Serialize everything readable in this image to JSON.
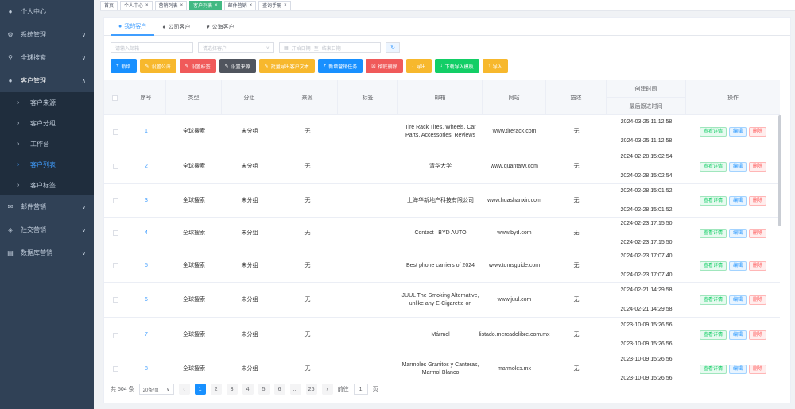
{
  "sidebar": {
    "items": [
      {
        "label": "个人中心",
        "icon": "user-icon"
      },
      {
        "label": "系统管理",
        "icon": "gear-icon"
      },
      {
        "label": "全球搜索",
        "icon": "search-icon"
      },
      {
        "label": "客户管理",
        "icon": "user-icon"
      },
      {
        "label": "邮件营销",
        "icon": "mail-icon"
      },
      {
        "label": "社交营销",
        "icon": "share-icon"
      },
      {
        "label": "数据库营销",
        "icon": "database-icon"
      }
    ],
    "subitems": [
      {
        "label": "客户来源"
      },
      {
        "label": "客户分组"
      },
      {
        "label": "工作台"
      },
      {
        "label": "客户列表"
      },
      {
        "label": "客户标签"
      }
    ]
  },
  "tags": [
    {
      "label": "首页"
    },
    {
      "label": "个人中心"
    },
    {
      "label": "营销列表"
    },
    {
      "label": "客户列表"
    },
    {
      "label": "邮件营销"
    },
    {
      "label": "查询手册"
    }
  ],
  "tabs": [
    {
      "label": "我的客户",
      "icon": "user-icon"
    },
    {
      "label": "公司客户",
      "icon": "user-icon"
    },
    {
      "label": "公海客户",
      "icon": "heart-icon"
    }
  ],
  "filters": {
    "keyword_placeholder": "请输入邮箱",
    "select_placeholder": "请选择客户",
    "date_start": "开始日期",
    "date_sep": "至",
    "date_end": "结束日期"
  },
  "buttons": [
    {
      "label": "新增",
      "color": "#1890ff"
    },
    {
      "label": "设置公海",
      "color": "#f7b82d"
    },
    {
      "label": "设置标签",
      "color": "#f05a5a"
    },
    {
      "label": "设置来源",
      "color": "#50555e"
    },
    {
      "label": "批量导出客户文本",
      "color": "#f7b82d"
    },
    {
      "label": "新增营销任务",
      "color": "#1890ff"
    },
    {
      "label": "彻底删除",
      "color": "#f05a5a"
    },
    {
      "label": "导出",
      "color": "#f7b82d"
    },
    {
      "label": "下载导入模板",
      "color": "#13ce66"
    },
    {
      "label": "导入",
      "color": "#f7b82d"
    }
  ],
  "columns": {
    "index": "序号",
    "type": "类型",
    "group": "分组",
    "source": "来源",
    "tag": "标签",
    "email": "邮箱",
    "website": "网站",
    "desc": "描述",
    "created": "创建时间",
    "updated": "最后跟进时间",
    "ops": "操作"
  },
  "rows": [
    {
      "index": "1",
      "type": "全球搜索",
      "group": "未分组",
      "source": "无",
      "tag": "",
      "email": "Tire Rack Tires, Wheels, Car Parts, Accessories, Reviews",
      "website": "www.tirerack.com",
      "desc": "无",
      "created": "2024-03-25 11:12:58",
      "updated": "2024-03-25 11:12:58"
    },
    {
      "index": "2",
      "type": "全球搜索",
      "group": "未分组",
      "source": "无",
      "tag": "",
      "email": "清华大学",
      "website": "www.quantatw.com",
      "desc": "无",
      "created": "2024-02-28 15:02:54",
      "updated": "2024-02-28 15:02:54"
    },
    {
      "index": "3",
      "type": "全球搜索",
      "group": "未分组",
      "source": "无",
      "tag": "",
      "email": "上海华新地产科技有限公司",
      "website": "www.huashanxin.com",
      "desc": "无",
      "created": "2024-02-28 15:01:52",
      "updated": "2024-02-28 15:01:52"
    },
    {
      "index": "4",
      "type": "全球搜索",
      "group": "未分组",
      "source": "无",
      "tag": "",
      "email": "Contact | BYD AUTO",
      "website": "www.byd.com",
      "desc": "无",
      "created": "2024-02-23 17:15:50",
      "updated": "2024-02-23 17:15:50"
    },
    {
      "index": "5",
      "type": "全球搜索",
      "group": "未分组",
      "source": "无",
      "tag": "",
      "email": "Best phone carriers of 2024",
      "website": "www.tomsguide.com",
      "desc": "无",
      "created": "2024-02-23 17:07:40",
      "updated": "2024-02-23 17:07:40"
    },
    {
      "index": "6",
      "type": "全球搜索",
      "group": "未分组",
      "source": "无",
      "tag": "",
      "email": "JUUL The Smoking Alternative, unlike any E-Cigarette on",
      "website": "www.juul.com",
      "desc": "无",
      "created": "2024-02-21 14:29:58",
      "updated": "2024-02-21 14:29:58"
    },
    {
      "index": "7",
      "type": "全球搜索",
      "group": "未分组",
      "source": "无",
      "tag": "",
      "email": "Mármol",
      "website": "listado.mercadolibre.com.mx",
      "desc": "无",
      "created": "2023-10-09 15:26:56",
      "updated": "2023-10-09 15:26:56"
    },
    {
      "index": "8",
      "type": "全球搜索",
      "group": "未分组",
      "source": "无",
      "tag": "",
      "email": "Marmoles Granitos y Canteras, Marmol Blanco",
      "website": "marmoles.mx",
      "desc": "无",
      "created": "2023-10-09 15:26:56",
      "updated": "2023-10-09 15:26:56"
    }
  ],
  "ops": {
    "view": "查看详情",
    "edit": "编辑",
    "del": "删除"
  },
  "pager": {
    "total": "共 504 条",
    "size": "20条/页",
    "pages": [
      "1",
      "2",
      "3",
      "4",
      "5",
      "6",
      "...",
      "26"
    ],
    "goto": "前往",
    "page_input": "1",
    "unit": "页"
  }
}
